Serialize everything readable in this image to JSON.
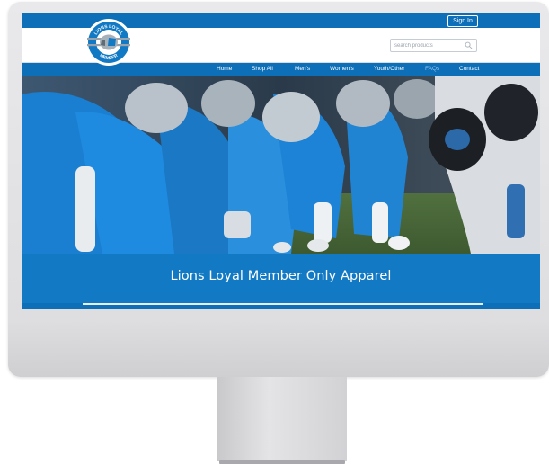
{
  "topbar": {
    "signin_label": "Sign In"
  },
  "logo": {
    "text_top": "LIONS LOYAL",
    "text_bottom": "MEMBER"
  },
  "search": {
    "placeholder": "search products",
    "icon": "search-icon"
  },
  "nav": {
    "items": [
      {
        "label": "Home"
      },
      {
        "label": "Shop All"
      },
      {
        "label": "Men's"
      },
      {
        "label": "Women's"
      },
      {
        "label": "Youth/Other"
      },
      {
        "label": "FAQs"
      },
      {
        "label": "Contact"
      }
    ]
  },
  "hero": {
    "image": "football-linemen-photo"
  },
  "banner": {
    "title": "Lions Loyal Member Only Apparel"
  },
  "colors": {
    "brand_blue": "#0d6fb8",
    "banner_blue": "#1279c4",
    "active_nav": "#8fc3ea"
  }
}
